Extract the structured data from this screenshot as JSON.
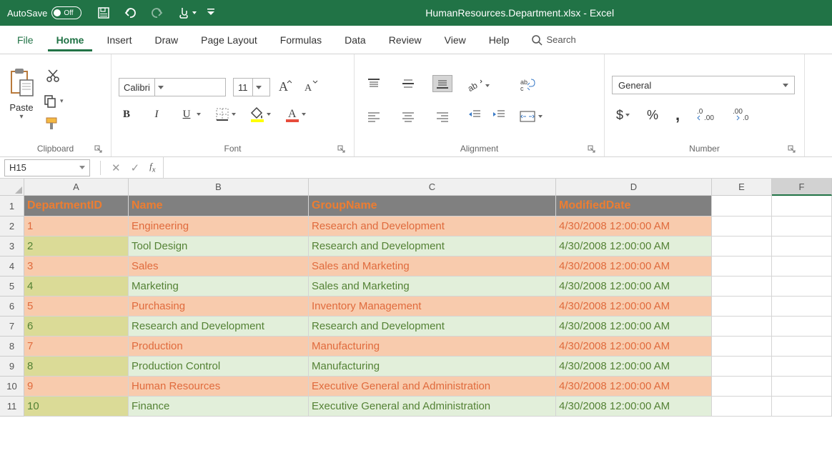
{
  "titleBar": {
    "autoSaveLabel": "AutoSave",
    "autoSaveState": "Off",
    "appTitle": "HumanResources.Department.xlsx - Excel"
  },
  "tabs": {
    "file": "File",
    "home": "Home",
    "insert": "Insert",
    "draw": "Draw",
    "pageLayout": "Page Layout",
    "formulas": "Formulas",
    "data": "Data",
    "review": "Review",
    "view": "View",
    "help": "Help",
    "search": "Search"
  },
  "ribbon": {
    "clipboard": {
      "paste": "Paste",
      "groupLabel": "Clipboard"
    },
    "font": {
      "name": "Calibri",
      "size": "11",
      "groupLabel": "Font"
    },
    "alignment": {
      "groupLabel": "Alignment"
    },
    "number": {
      "format": "General",
      "groupLabel": "Number"
    }
  },
  "formulaBar": {
    "nameBox": "H15",
    "formula": ""
  },
  "columns": [
    "A",
    "B",
    "C",
    "D",
    "E",
    "F"
  ],
  "rows": [
    "1",
    "2",
    "3",
    "4",
    "5",
    "6",
    "7",
    "8",
    "9",
    "10",
    "11"
  ],
  "table": {
    "headers": {
      "col0": "DepartmentID",
      "col1": "Name",
      "col2": "GroupName",
      "col3": "ModifiedDate"
    },
    "data": [
      {
        "id": "1",
        "name": "Engineering",
        "group": "Research and Development",
        "mod": "4/30/2008 12:00:00 AM"
      },
      {
        "id": "2",
        "name": "Tool Design",
        "group": "Research and Development",
        "mod": "4/30/2008 12:00:00 AM"
      },
      {
        "id": "3",
        "name": "Sales",
        "group": "Sales and Marketing",
        "mod": "4/30/2008 12:00:00 AM"
      },
      {
        "id": "4",
        "name": "Marketing",
        "group": "Sales and Marketing",
        "mod": "4/30/2008 12:00:00 AM"
      },
      {
        "id": "5",
        "name": "Purchasing",
        "group": "Inventory Management",
        "mod": "4/30/2008 12:00:00 AM"
      },
      {
        "id": "6",
        "name": "Research and Development",
        "group": "Research and Development",
        "mod": "4/30/2008 12:00:00 AM"
      },
      {
        "id": "7",
        "name": "Production",
        "group": "Manufacturing",
        "mod": "4/30/2008 12:00:00 AM"
      },
      {
        "id": "8",
        "name": "Production Control",
        "group": "Manufacturing",
        "mod": "4/30/2008 12:00:00 AM"
      },
      {
        "id": "9",
        "name": "Human Resources",
        "group": "Executive General and Administration",
        "mod": "4/30/2008 12:00:00 AM"
      },
      {
        "id": "10",
        "name": "Finance",
        "group": "Executive General and Administration",
        "mod": "4/30/2008 12:00:00 AM"
      }
    ]
  }
}
